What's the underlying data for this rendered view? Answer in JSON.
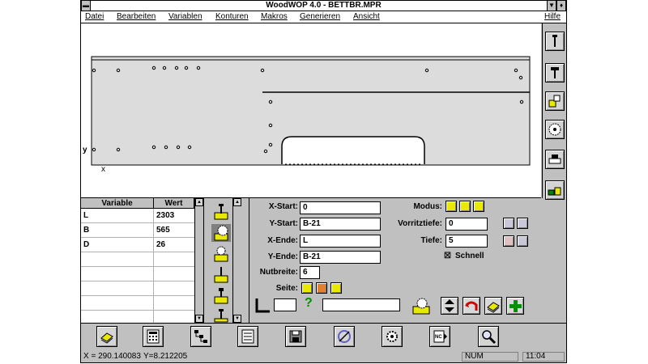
{
  "window": {
    "title": "WoodWOP 4.0 - BETTBR.MPR"
  },
  "menubar": {
    "items": [
      "Datei",
      "Bearbeiten",
      "Variablen",
      "Konturen",
      "Makros",
      "Generieren",
      "Ansicht"
    ],
    "help": "Hilfe"
  },
  "drawing": {
    "axis_y": "y",
    "axis_x": "x"
  },
  "right_toolbar": {
    "icons": [
      "vertical-drill-icon",
      "screw-drill-icon",
      "horizontal-drill-icon",
      "saw-blade-icon",
      "machine-icon",
      "material-pieces-icon"
    ]
  },
  "variables": {
    "headers": {
      "name": "Variable",
      "value": "Wert"
    },
    "rows": [
      {
        "name": "L",
        "value": "2303"
      },
      {
        "name": "B",
        "value": "565"
      },
      {
        "name": "D",
        "value": "26"
      }
    ]
  },
  "form": {
    "x_start": {
      "label": "X-Start:",
      "value": "0"
    },
    "y_start": {
      "label": "Y-Start:",
      "value": "B-21"
    },
    "x_ende": {
      "label": "X-Ende:",
      "value": "L"
    },
    "y_ende": {
      "label": "Y-Ende:",
      "value": "B-21"
    },
    "nutbreite": {
      "label": "Nutbreite:",
      "value": "6"
    },
    "seite": {
      "label": "Seite:"
    },
    "modus": {
      "label": "Modus:"
    },
    "vorritztiefe": {
      "label": "Vorritztiefe:",
      "value": "0"
    },
    "tiefe": {
      "label": "Tiefe:",
      "value": "5"
    },
    "schnell": {
      "label": "Schnell",
      "checked": true
    }
  },
  "bottom_toolbar": {
    "icons": [
      "book-icon",
      "calculator-icon",
      "tree-icon",
      "list-icon",
      "disk-icon",
      "cut-icon",
      "gear-tool-icon",
      "nc-icon",
      "zoom-icon"
    ]
  },
  "status": {
    "x_coord": "X = 290.140083",
    "y_coord": "Y=8.212205",
    "num": "NUM",
    "time": "11:04"
  }
}
